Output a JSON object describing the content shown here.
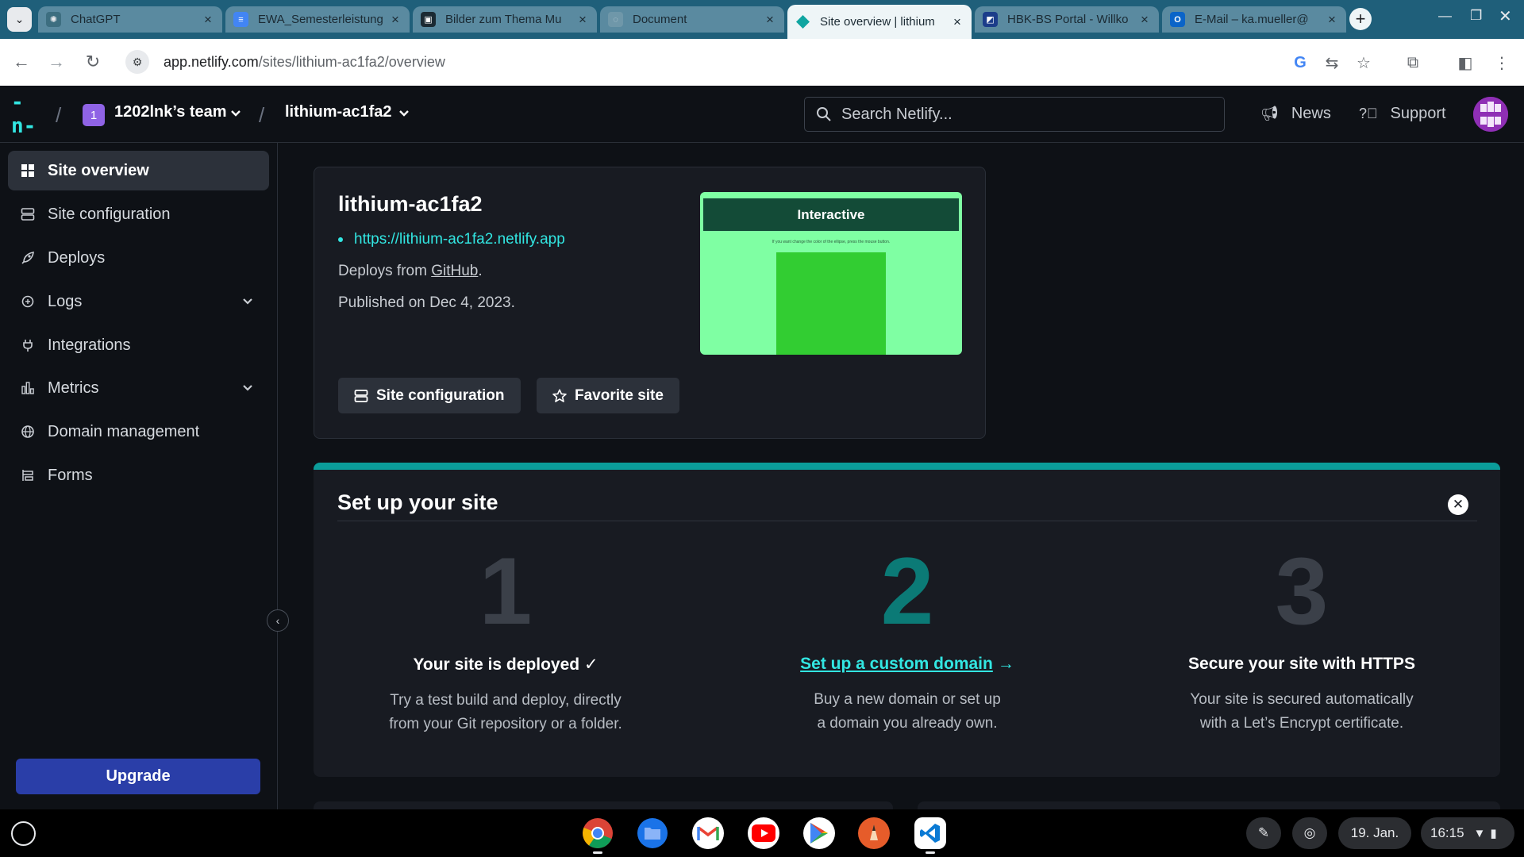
{
  "browser": {
    "tabs": [
      {
        "title": "ChatGPT",
        "favicon": "chatgpt-icon",
        "active": false
      },
      {
        "title": "EWA_Semesterleistung",
        "favicon": "google-docs-icon",
        "active": false
      },
      {
        "title": "Bilder zum Thema Mu",
        "favicon": "unsplash-icon",
        "active": false
      },
      {
        "title": "Document",
        "favicon": "globe-icon",
        "active": false
      },
      {
        "title": "Site overview | lithium",
        "favicon": "netlify-icon",
        "active": true
      },
      {
        "title": "HBK-BS Portal - Willko",
        "favicon": "portal-icon",
        "active": false
      },
      {
        "title": "E-Mail – ka.mueller@",
        "favicon": "outlook-icon",
        "active": false
      }
    ],
    "url_host": "app.netlify.com",
    "url_path": "/sites/lithium-ac1fa2/overview",
    "new_tab_label": "+"
  },
  "header": {
    "logo_text": "-n-",
    "team_initial": "1",
    "team_name": "1202lnk’s team",
    "site_name": "lithium-ac1fa2",
    "search_placeholder": "Search Netlify...",
    "news_label": "News",
    "support_label": "Support"
  },
  "sidebar": {
    "items": [
      {
        "label": "Site overview",
        "icon": "grid-icon",
        "active": true
      },
      {
        "label": "Site configuration",
        "icon": "config-icon"
      },
      {
        "label": "Deploys",
        "icon": "rocket-icon"
      },
      {
        "label": "Logs",
        "icon": "logs-icon",
        "expandable": true
      },
      {
        "label": "Integrations",
        "icon": "plug-icon"
      },
      {
        "label": "Metrics",
        "icon": "bar-chart-icon",
        "expandable": true
      },
      {
        "label": "Domain management",
        "icon": "globe-icon"
      },
      {
        "label": "Forms",
        "icon": "form-icon"
      }
    ],
    "upgrade_label": "Upgrade"
  },
  "overview": {
    "site_title": "lithium-ac1fa2",
    "site_url": "https://lithium-ac1fa2.netlify.app",
    "deploys_prefix": "Deploys from ",
    "deploys_source": "GitHub",
    "deploys_suffix": ".",
    "published": "Published on Dec 4, 2023.",
    "preview_title": "Interactive",
    "preview_hint": "If you want change the color of the ellipse, press the mouse button.",
    "btn_config": "Site configuration",
    "btn_favorite": "Favorite site"
  },
  "setup": {
    "title": "Set up your site",
    "steps": [
      {
        "num": "1",
        "heading": "Your site is deployed ✓",
        "desc1": "Try a test build and deploy, directly",
        "desc2": "from your Git repository or a folder."
      },
      {
        "num": "2",
        "heading": "Set up a custom domain",
        "arrow": "→",
        "desc1": "Buy a new domain or set up",
        "desc2": "a domain you already own."
      },
      {
        "num": "3",
        "heading": "Secure your site with HTTPS",
        "desc1": "Your site is secured automatically",
        "desc2": "with a Let’s Encrypt certificate."
      }
    ]
  },
  "taskbar": {
    "date": "19. Jan.",
    "time": "16:15"
  },
  "colors": {
    "accent_teal": "#32e6e2",
    "upgrade_blue": "#2a3ea8",
    "team_purple": "#8f63e5",
    "preview_green": "#7fffa3"
  }
}
